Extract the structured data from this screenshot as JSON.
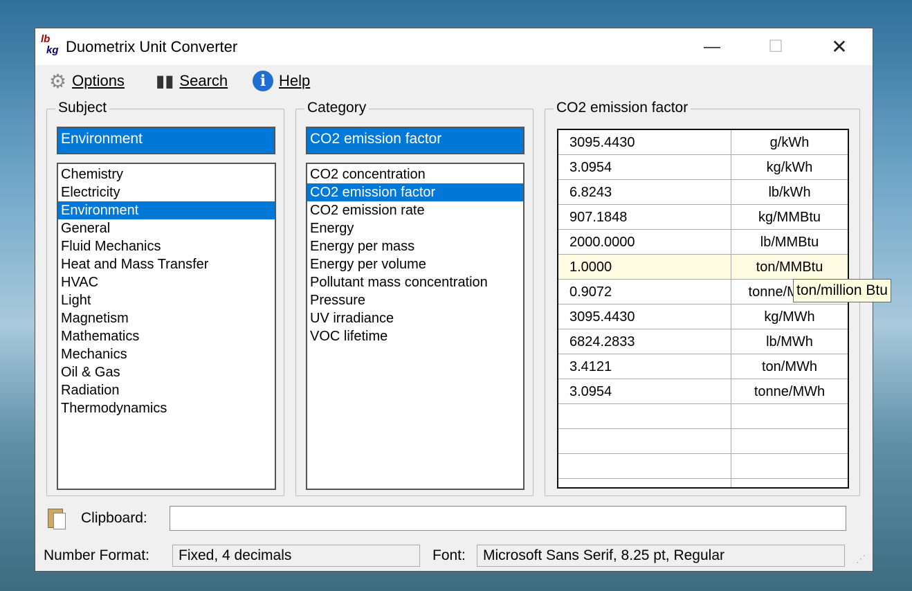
{
  "window": {
    "title": "Duometrix Unit Converter",
    "icon_text_top": "lb",
    "icon_text_bottom": "kg"
  },
  "menu": [
    {
      "label": "Options",
      "icon": "gear-icon"
    },
    {
      "label": "Search",
      "icon": "binoculars-icon"
    },
    {
      "label": "Help",
      "icon": "info-icon"
    }
  ],
  "subject": {
    "label": "Subject",
    "selected": "Environment",
    "items": [
      "Chemistry",
      "Electricity",
      "Environment",
      "General",
      "Fluid Mechanics",
      "Heat and Mass Transfer",
      "HVAC",
      "Light",
      "Magnetism",
      "Mathematics",
      "Mechanics",
      "Oil & Gas",
      "Radiation",
      "Thermodynamics"
    ]
  },
  "category": {
    "label": "Category",
    "selected": "CO2 emission factor",
    "items": [
      "CO2 concentration",
      "CO2 emission factor",
      "CO2 emission rate",
      "Energy",
      "Energy per mass",
      "Energy per volume",
      "Pollutant mass concentration",
      "Pressure",
      "UV irradiance",
      "VOC lifetime"
    ]
  },
  "results": {
    "label": "CO2 emission factor",
    "rows": [
      [
        "3095.4430",
        "g/kWh"
      ],
      [
        "3.0954",
        "kg/kWh"
      ],
      [
        "6.8243",
        "lb/kWh"
      ],
      [
        "907.1848",
        "kg/MMBtu"
      ],
      [
        "2000.0000",
        "lb/MMBtu"
      ],
      [
        "1.0000",
        "ton/MMBtu"
      ],
      [
        "0.9072",
        "tonne/MMBtu"
      ],
      [
        "3095.4430",
        "kg/MWh"
      ],
      [
        "6824.2833",
        "lb/MWh"
      ],
      [
        "3.4121",
        "ton/MWh"
      ],
      [
        "3.0954",
        "tonne/MWh"
      ],
      [
        "",
        ""
      ],
      [
        "",
        ""
      ],
      [
        "",
        ""
      ],
      [
        "",
        ""
      ]
    ],
    "highlighted_row": 5,
    "tooltip": "ton/million Btu"
  },
  "clipboard": {
    "label": "Clipboard:",
    "value": ""
  },
  "status": {
    "number_format_label": "Number Format:",
    "number_format": "Fixed, 4 decimals",
    "font_label": "Font:",
    "font": "Microsoft Sans Serif, 8.25 pt, Regular"
  }
}
